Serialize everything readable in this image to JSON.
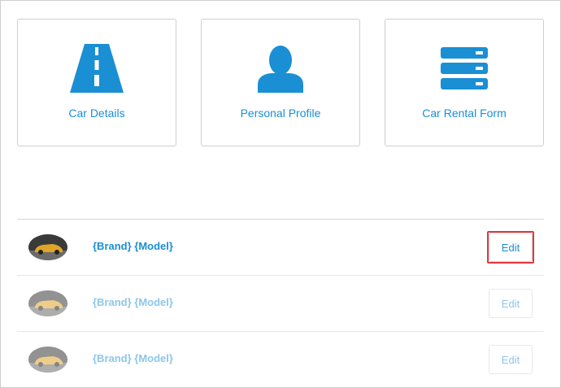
{
  "cards": [
    {
      "label": "Car Details",
      "icon": "road-icon"
    },
    {
      "label": "Personal Profile",
      "icon": "person-icon"
    },
    {
      "label": "Car Rental Form",
      "icon": "form-list-icon"
    }
  ],
  "rows": [
    {
      "title": "{Brand} {Model}",
      "edit_label": "Edit",
      "thumb": "car-thumbnail"
    },
    {
      "title": "{Brand} {Model}",
      "edit_label": "Edit",
      "thumb": "car-thumbnail"
    },
    {
      "title": "{Brand} {Model}",
      "edit_label": "Edit",
      "thumb": "car-thumbnail"
    }
  ],
  "colors": {
    "accent": "#1a8fd4",
    "accent_dim": "#8cc6ea",
    "highlight": "#e0393e",
    "border": "#cfcfcf"
  }
}
